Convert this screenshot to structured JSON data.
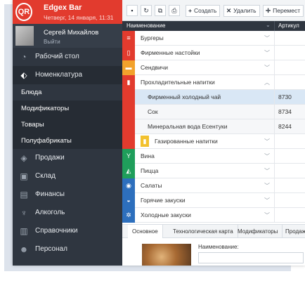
{
  "brand": {
    "logo": "QR",
    "title": "Edgex Bar",
    "date": "Четверг, 14 января, 11:31"
  },
  "user": {
    "name": "Сергей Михайлов",
    "logout": "Выйти"
  },
  "nav": {
    "dashboard": "Рабочий стол",
    "nomenclature": "Номенклатура",
    "sub": [
      "Блюда",
      "Модификаторы",
      "Товары",
      "Полуфабрикаты"
    ],
    "sales": "Продажи",
    "warehouse": "Склад",
    "finance": "Финансы",
    "alcohol": "Алкоголь",
    "references": "Справочники",
    "staff": "Персонал"
  },
  "toolbar": {
    "create": "Создать",
    "delete": "Удалить",
    "move": "Перемест"
  },
  "table": {
    "col_name": "Наименование",
    "col_article": "Артикул",
    "rows": [
      {
        "label": "Бургеры",
        "article": "",
        "color": "#e23b2e",
        "icon": "burger-icon"
      },
      {
        "label": "Фирменные настойки",
        "article": "",
        "color": "#e23b2e",
        "icon": "bottle-icon"
      },
      {
        "label": "Сендвичи",
        "article": "",
        "color": "#f2a22c",
        "icon": "sandwich-icon"
      },
      {
        "label": "Прохладительные напитки",
        "article": "",
        "color": "#e23b2e",
        "icon": "drinks-icon"
      },
      {
        "label": "Фирменный холодный чай",
        "article": "8730",
        "color": "#e23b2e"
      },
      {
        "label": "Сок",
        "article": "8734",
        "color": "#e23b2e"
      },
      {
        "label": "Минеральная вода Есентуки",
        "article": "8244",
        "color": "#e23b2e"
      },
      {
        "label": "Газированные напитки",
        "article": "",
        "color": "#e23b2e",
        "icon": "soda-icon"
      },
      {
        "label": "Вина",
        "article": "",
        "color": "#1f9e5b",
        "icon": "wine-icon"
      },
      {
        "label": "Пицца",
        "article": "",
        "color": "#1f9e5b",
        "icon": "pizza-icon"
      },
      {
        "label": "Салаты",
        "article": "",
        "color": "#2d6fbd",
        "icon": "salad-icon"
      },
      {
        "label": "Горячие закуски",
        "article": "",
        "color": "#2d6fbd",
        "icon": "hot-snack-icon"
      },
      {
        "label": "Холодные закуски",
        "article": "",
        "color": "#2d6fbd",
        "icon": "cold-snack-icon"
      }
    ]
  },
  "tabs": [
    "Основное",
    "Технологическая карта",
    "Модификаторы",
    "Продажи"
  ],
  "detail": {
    "name_label": "Наименование:"
  }
}
